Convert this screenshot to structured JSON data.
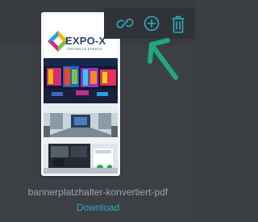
{
  "toolbar": {
    "link_icon": "link-icon",
    "add_icon": "plus-circle-icon",
    "delete_icon": "trash-icon"
  },
  "annotation": {
    "arrow_color": "#1fa77f"
  },
  "card": {
    "logo_title": "EXPO-X",
    "logo_subtitle": "VIRTUELLE EVENTS",
    "logo_colors": [
      "#2a9de0",
      "#f2b705",
      "#d62e6b",
      "#7dc242"
    ]
  },
  "file": {
    "name": "bannerplatzhalter-konvertiert-pdf",
    "download_label": "Download"
  },
  "colors": {
    "accent": "#33a9b8",
    "background": "#3b3f44",
    "toolbar": "#2f3337"
  }
}
